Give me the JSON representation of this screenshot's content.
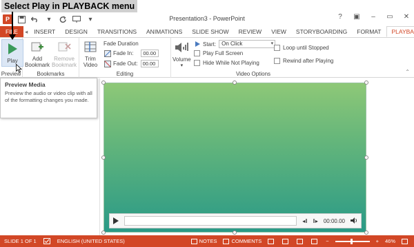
{
  "annotation": {
    "text": "Select Play in PLAYBACK menu"
  },
  "window": {
    "title": "Presentation3 - PowerPoint",
    "app_logo": "P",
    "controls": {
      "help": "?",
      "ribbon_display": "▣",
      "minimize": "–",
      "restore": "▭",
      "close": "✕"
    }
  },
  "qat": {
    "save_icon": "save-icon",
    "undo_icon": "undo-icon",
    "redo_icon": "redo-icon"
  },
  "tabs": [
    {
      "label": "FILE"
    },
    {
      "label": "INSERT"
    },
    {
      "label": "DESIGN"
    },
    {
      "label": "TRANSITIONS"
    },
    {
      "label": "ANIMATIONS"
    },
    {
      "label": "SLIDE SHOW"
    },
    {
      "label": "REVIEW"
    },
    {
      "label": "VIEW"
    },
    {
      "label": "STORYBOARDING"
    },
    {
      "label": "FORMAT"
    },
    {
      "label": "PLAYBACK"
    }
  ],
  "ribbon": {
    "preview": {
      "group": "Preview",
      "play": "Play"
    },
    "bookmarks": {
      "group": "Bookmarks",
      "add_line1": "Add",
      "add_line2": "Bookmark",
      "remove_line1": "Remove",
      "remove_line2": "Bookmark"
    },
    "editing": {
      "group": "Editing",
      "trim_line1": "Trim",
      "trim_line2": "Video",
      "fade_duration": "Fade Duration",
      "fade_in_label": "Fade In:",
      "fade_in_value": "00.00",
      "fade_out_label": "Fade Out:",
      "fade_out_value": "00.00"
    },
    "video_options": {
      "group": "Video Options",
      "volume": "Volume",
      "start_label": "Start:",
      "start_value": "On Click",
      "play_full_screen": "Play Full Screen",
      "hide_while_not_playing": "Hide While Not Playing",
      "loop_until_stopped": "Loop until Stopped",
      "rewind_after_playing": "Rewind after Playing"
    }
  },
  "tooltip": {
    "title": "Preview Media",
    "body": "Preview the audio or video clip with all of the formatting changes you made."
  },
  "player": {
    "time": "00:00.00"
  },
  "status": {
    "slide": "SLIDE 1 OF 1",
    "language": "ENGLISH (UNITED STATES)",
    "notes": "NOTES",
    "comments": "COMMENTS",
    "zoom_minus": "−",
    "zoom_plus": "+",
    "zoom": "46%"
  },
  "colors": {
    "accent": "#d24726",
    "video_top": "#8ec877",
    "video_bottom": "#2a9a87"
  }
}
